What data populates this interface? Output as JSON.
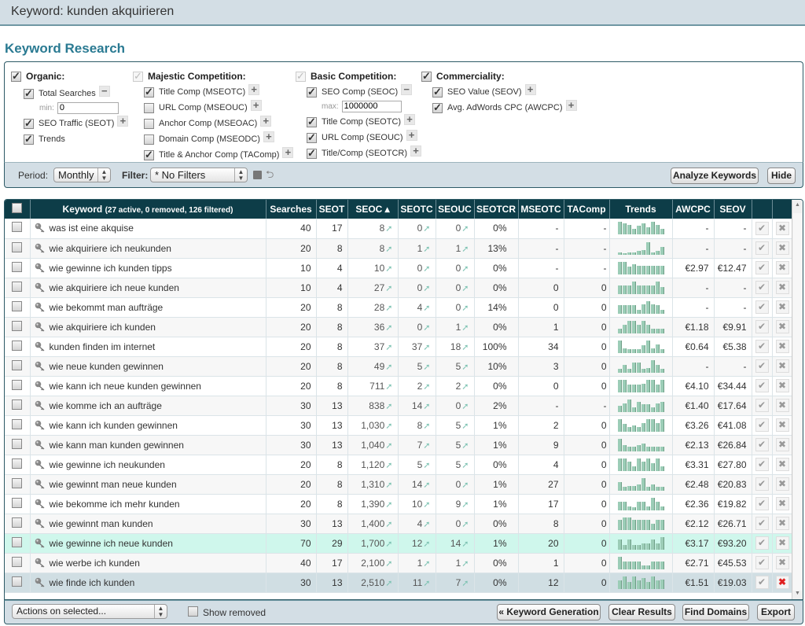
{
  "header": {
    "title": "Keyword: kunden akquirieren"
  },
  "page_title": "Keyword Research",
  "options": {
    "organic": {
      "label": "Organic:",
      "checked": true,
      "items": [
        {
          "label": "Total Searches",
          "checked": true,
          "toggle": "minus",
          "min_label": "min:",
          "min_value": "0"
        },
        {
          "label": "SEO Traffic (SEOT)",
          "checked": true,
          "toggle": "plus"
        },
        {
          "label": "Trends",
          "checked": true
        }
      ]
    },
    "majestic": {
      "label": "Majestic Competition:",
      "checked": true,
      "items": [
        {
          "label": "Title Comp (MSEOTC)",
          "checked": true
        },
        {
          "label": "URL Comp (MSEOUC)",
          "checked": false
        },
        {
          "label": "Anchor Comp (MSEOAC)",
          "checked": false
        },
        {
          "label": "Domain Comp (MSEODC)",
          "checked": false
        },
        {
          "label": "Title & Anchor Comp (TAComp)",
          "checked": true
        }
      ]
    },
    "basic": {
      "label": "Basic Competition:",
      "checked": true,
      "items": [
        {
          "label": "SEO Comp (SEOC)",
          "checked": true,
          "toggle": "minus",
          "max_label": "max:",
          "max_value": "1000000"
        },
        {
          "label": "Title Comp (SEOTC)",
          "checked": true
        },
        {
          "label": "URL Comp (SEOUC)",
          "checked": true
        },
        {
          "label": "Title/Comp (SEOTCR)",
          "checked": true
        }
      ]
    },
    "commerciality": {
      "label": "Commerciality:",
      "checked": true,
      "items": [
        {
          "label": "SEO Value (SEOV)",
          "checked": true
        },
        {
          "label": "Avg. AdWords CPC (AWCPC)",
          "checked": true
        }
      ]
    }
  },
  "toolbar": {
    "period_label": "Period:",
    "period_value": "Monthly",
    "filter_label": "Filter:",
    "filter_value": "* No Filters",
    "analyze_label": "Analyze Keywords",
    "hide_label": "Hide"
  },
  "table": {
    "headers": {
      "keyword": "Keyword",
      "keyword_info": "(27 active, 0 removed, 126 filtered)",
      "searches": "Searches",
      "seot": "SEOT",
      "seoc": "SEOC ▴",
      "seotc": "SEOTC",
      "seouc": "SEOUC",
      "seotcr": "SEOTCR",
      "mseotc": "MSEOTC",
      "tacomp": "TAComp",
      "trends": "Trends",
      "awcpc": "AWCPC",
      "seov": "SEOV"
    },
    "rows": [
      {
        "keyword": "was ist eine akquise",
        "searches": "40",
        "seot": "17",
        "seoc": "8",
        "seotc": "0",
        "seouc": "0",
        "seotcr": "0%",
        "mseotc": "-",
        "tacomp": "-",
        "trend": [
          9,
          8,
          7,
          4,
          6,
          8,
          5,
          9,
          7,
          4
        ],
        "awcpc": "-",
        "seov": "-"
      },
      {
        "keyword": "wie akquiriere ich neukunden",
        "searches": "20",
        "seot": "8",
        "seoc": "8",
        "seotc": "1",
        "seouc": "1",
        "seotcr": "13%",
        "mseotc": "-",
        "tacomp": "-",
        "trend": [
          2,
          1,
          2,
          2,
          3,
          4,
          10,
          2,
          3,
          6
        ],
        "awcpc": "-",
        "seov": "-"
      },
      {
        "keyword": "wie gewinne ich kunden tipps",
        "searches": "10",
        "seot": "4",
        "seoc": "10",
        "seotc": "0",
        "seouc": "0",
        "seotcr": "0%",
        "mseotc": "-",
        "tacomp": "-",
        "trend": [
          10,
          10,
          6,
          8,
          7,
          7,
          7,
          7,
          7,
          7
        ],
        "awcpc": "€2.97",
        "seov": "€12.47"
      },
      {
        "keyword": "wie akquiriere ich neue kunden",
        "searches": "10",
        "seot": "4",
        "seoc": "27",
        "seotc": "0",
        "seouc": "0",
        "seotcr": "0%",
        "mseotc": "0",
        "tacomp": "0",
        "trend": [
          6,
          6,
          6,
          9,
          6,
          6,
          6,
          6,
          9,
          5
        ],
        "awcpc": "-",
        "seov": "-"
      },
      {
        "keyword": "wie bekommt man aufträge",
        "searches": "20",
        "seot": "8",
        "seoc": "28",
        "seotc": "4",
        "seouc": "0",
        "seotcr": "14%",
        "mseotc": "0",
        "tacomp": "0",
        "trend": [
          6,
          6,
          6,
          6,
          3,
          7,
          9,
          7,
          6,
          3
        ],
        "awcpc": "-",
        "seov": "-"
      },
      {
        "keyword": "wie akquiriere ich kunden",
        "searches": "20",
        "seot": "8",
        "seoc": "36",
        "seotc": "0",
        "seouc": "1",
        "seotcr": "0%",
        "mseotc": "1",
        "tacomp": "0",
        "trend": [
          4,
          7,
          10,
          10,
          7,
          10,
          7,
          4,
          4,
          4
        ],
        "awcpc": "€1.18",
        "seov": "€9.91"
      },
      {
        "keyword": "kunden finden im internet",
        "searches": "20",
        "seot": "8",
        "seoc": "37",
        "seotc": "37",
        "seouc": "18",
        "seotcr": "100%",
        "mseotc": "34",
        "tacomp": "0",
        "trend": [
          10,
          4,
          3,
          3,
          3,
          6,
          10,
          4,
          7,
          3
        ],
        "awcpc": "€0.64",
        "seov": "€5.38"
      },
      {
        "keyword": "wie neue kunden gewinnen",
        "searches": "20",
        "seot": "8",
        "seoc": "49",
        "seotc": "5",
        "seouc": "5",
        "seotcr": "10%",
        "mseotc": "3",
        "tacomp": "0",
        "trend": [
          3,
          6,
          3,
          8,
          8,
          3,
          4,
          10,
          6,
          3
        ],
        "awcpc": "-",
        "seov": "-"
      },
      {
        "keyword": "wie kann ich neue kunden gewinnen",
        "searches": "20",
        "seot": "8",
        "seoc": "711",
        "seotc": "2",
        "seouc": "2",
        "seotcr": "0%",
        "mseotc": "0",
        "tacomp": "0",
        "trend": [
          10,
          10,
          6,
          6,
          6,
          7,
          10,
          10,
          6,
          10
        ],
        "awcpc": "€4.10",
        "seov": "€34.44"
      },
      {
        "keyword": "wie komme ich an aufträge",
        "searches": "30",
        "seot": "13",
        "seoc": "838",
        "seotc": "14",
        "seouc": "0",
        "seotcr": "2%",
        "mseotc": "-",
        "tacomp": "-",
        "trend": [
          5,
          7,
          10,
          4,
          8,
          6,
          6,
          4,
          7,
          8
        ],
        "awcpc": "€1.40",
        "seov": "€17.64"
      },
      {
        "keyword": "wie kann ich kunden gewinnen",
        "searches": "30",
        "seot": "13",
        "seoc": "1,030",
        "seotc": "8",
        "seouc": "5",
        "seotcr": "1%",
        "mseotc": "2",
        "tacomp": "0",
        "trend": [
          10,
          6,
          4,
          5,
          4,
          7,
          10,
          10,
          7,
          10
        ],
        "awcpc": "€3.26",
        "seov": "€41.08"
      },
      {
        "keyword": "wie kann man kunden gewinnen",
        "searches": "30",
        "seot": "13",
        "seoc": "1,040",
        "seotc": "7",
        "seouc": "5",
        "seotcr": "1%",
        "mseotc": "9",
        "tacomp": "0",
        "trend": [
          10,
          5,
          4,
          4,
          5,
          6,
          4,
          4,
          4,
          4
        ],
        "awcpc": "€2.13",
        "seov": "€26.84"
      },
      {
        "keyword": "wie gewinne ich neukunden",
        "searches": "20",
        "seot": "8",
        "seoc": "1,120",
        "seotc": "5",
        "seouc": "5",
        "seotcr": "0%",
        "mseotc": "4",
        "tacomp": "0",
        "trend": [
          8,
          8,
          6,
          3,
          8,
          6,
          8,
          5,
          8,
          3
        ],
        "awcpc": "€3.31",
        "seov": "€27.80"
      },
      {
        "keyword": "wie gewinnt man neue kunden",
        "searches": "20",
        "seot": "8",
        "seoc": "1,310",
        "seotc": "14",
        "seouc": "0",
        "seotcr": "1%",
        "mseotc": "27",
        "tacomp": "0",
        "trend": [
          7,
          3,
          4,
          4,
          5,
          10,
          3,
          5,
          3,
          3
        ],
        "awcpc": "€2.48",
        "seov": "€20.83"
      },
      {
        "keyword": "wie bekomme ich mehr kunden",
        "searches": "20",
        "seot": "8",
        "seoc": "1,390",
        "seotc": "10",
        "seouc": "9",
        "seotcr": "1%",
        "mseotc": "17",
        "tacomp": "0",
        "trend": [
          6,
          6,
          3,
          2,
          6,
          6,
          3,
          9,
          6,
          3
        ],
        "awcpc": "€2.36",
        "seov": "€19.82"
      },
      {
        "keyword": "wie gewinnt man kunden",
        "searches": "30",
        "seot": "13",
        "seoc": "1,400",
        "seotc": "4",
        "seouc": "0",
        "seotcr": "0%",
        "mseotc": "8",
        "tacomp": "0",
        "trend": [
          8,
          10,
          10,
          8,
          8,
          8,
          8,
          5,
          8,
          8
        ],
        "awcpc": "€2.12",
        "seov": "€26.71"
      },
      {
        "keyword": "wie gewinne ich neue kunden",
        "searches": "70",
        "seot": "29",
        "seoc": "1,700",
        "seotc": "12",
        "seouc": "14",
        "seotcr": "1%",
        "mseotc": "20",
        "tacomp": "0",
        "trend": [
          8,
          4,
          8,
          4,
          4,
          5,
          5,
          8,
          5,
          10
        ],
        "awcpc": "€3.17",
        "seov": "€93.20"
      },
      {
        "keyword": "wie werbe ich kunden",
        "searches": "40",
        "seot": "17",
        "seoc": "2,100",
        "seotc": "1",
        "seouc": "1",
        "seotcr": "0%",
        "mseotc": "1",
        "tacomp": "0",
        "trend": [
          10,
          6,
          6,
          6,
          6,
          3,
          3,
          6,
          6,
          6
        ],
        "awcpc": "€2.71",
        "seov": "€45.53"
      },
      {
        "keyword": "wie finde ich kunden",
        "searches": "30",
        "seot": "13",
        "seoc": "2,510",
        "seotc": "11",
        "seouc": "7",
        "seotcr": "0%",
        "mseotc": "12",
        "tacomp": "0",
        "trend": [
          6,
          9,
          5,
          9,
          6,
          8,
          5,
          9,
          6,
          7
        ],
        "awcpc": "€1.51",
        "seov": "€19.03"
      }
    ]
  },
  "footer": {
    "actions_value": "Actions on selected...",
    "show_removed_label": "Show removed",
    "keyword_generation_label": "« Keyword Generation",
    "clear_results_label": "Clear Results",
    "find_domains_label": "Find Domains",
    "export_label": "Export"
  }
}
